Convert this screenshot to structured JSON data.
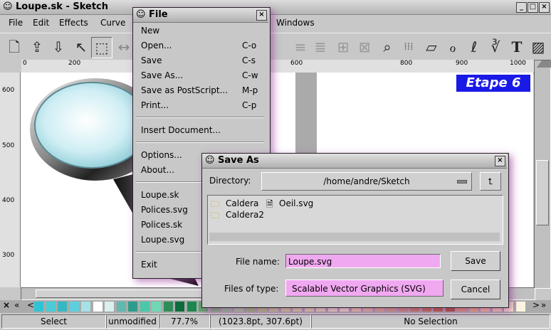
{
  "window": {
    "title": "Loupe.sk - Sketch",
    "close_glyph": "×",
    "min_glyph": "_",
    "max_glyph": "□",
    "close2_glyph": "×"
  },
  "menubar": {
    "items": [
      "File",
      "Edit",
      "Effects",
      "Curve",
      "Windows"
    ]
  },
  "ruler": {
    "h_ticks": [
      "0",
      "200",
      "600",
      "800",
      "900",
      "1000"
    ],
    "v_ticks": [
      "600",
      "500",
      "400",
      "300"
    ]
  },
  "canvas": {
    "banner": "Etape 6"
  },
  "file_menu": {
    "title": "File",
    "items": [
      {
        "label": "New",
        "shortcut": ""
      },
      {
        "label": "Open...",
        "shortcut": "C-o"
      },
      {
        "label": "Save",
        "shortcut": "C-s"
      },
      {
        "label": "Save As...",
        "shortcut": "C-w"
      },
      {
        "label": "Save as PostScript...",
        "shortcut": "M-p"
      },
      {
        "label": "Print...",
        "shortcut": "C-p"
      },
      {
        "label": "Insert Document...",
        "shortcut": ""
      },
      {
        "label": "Options...",
        "shortcut": ""
      },
      {
        "label": "About...",
        "shortcut": ""
      },
      {
        "label": "Loupe.sk",
        "shortcut": ""
      },
      {
        "label": "Polices.svg",
        "shortcut": ""
      },
      {
        "label": "Polices.sk",
        "shortcut": ""
      },
      {
        "label": "Loupe.svg",
        "shortcut": ""
      },
      {
        "label": "Exit",
        "shortcut": ""
      }
    ]
  },
  "save_dialog": {
    "title": "Save As",
    "directory_label": "Directory:",
    "directory_value": "/home/andre/Sketch",
    "files": [
      {
        "name": "Caldera",
        "type": "folder"
      },
      {
        "name": "Oeil.svg",
        "type": "file"
      },
      {
        "name": "Caldera2",
        "type": "folder"
      }
    ],
    "file_name_label": "File name:",
    "file_name_value": "Loupe.svg",
    "save_label": "Save",
    "type_label": "Files of type:",
    "type_value": "Scalable Vector Graphics (SVG)",
    "cancel_label": "Cancel"
  },
  "palette": {
    "nav": [
      "×",
      "«",
      "<"
    ],
    "nav_right": [
      ">",
      "»"
    ],
    "colors": [
      "#2ec4d6",
      "#48ccd8",
      "#36b8c4",
      "#5ed0dc",
      "#a4e2e6",
      "#ffffff",
      "#d8f0f0",
      "#60b8b0",
      "#2c9c8c",
      "#48c8a8",
      "#70d8b4",
      "#2e8c58",
      "#0c6c3c",
      "#1c8850",
      "#58a868",
      "#70c070",
      "#88d088",
      "#a0d898",
      "#8cc868",
      "#a8d070",
      "#b8d880",
      "#c8e088",
      "#d0e494",
      "#d8e8a0",
      "#e0ecb0",
      "#e8eec0",
      "#f0f0c8",
      "#e8d8a0",
      "#e0c890",
      "#d8b880",
      "#d0a870",
      "#c89860",
      "#c08850",
      "#b87840",
      "#b06830",
      "#a85820",
      "#dca060",
      "#e8b870",
      "#f0c890",
      "#f4d8a8",
      "#f8e8c4",
      "#fcf4e0"
    ]
  },
  "status": {
    "mode": "Select",
    "modified": "unmodified",
    "zoom": "77.7%",
    "coords": "(1023.8pt, 307.6pt)",
    "selection": "No Selection"
  },
  "toolbar": {
    "icons": [
      "new-doc-icon",
      "open-icon",
      "save-icon",
      "edit-icon",
      "select-icon",
      "undo-icon",
      "align-icon",
      "align2-icon",
      "group-icon",
      "ungroup-icon",
      "zoom-icon",
      "grid-icon",
      "rect-icon",
      "ellipse-icon",
      "curve-icon",
      "pen-icon",
      "text-icon",
      "image-icon"
    ]
  }
}
